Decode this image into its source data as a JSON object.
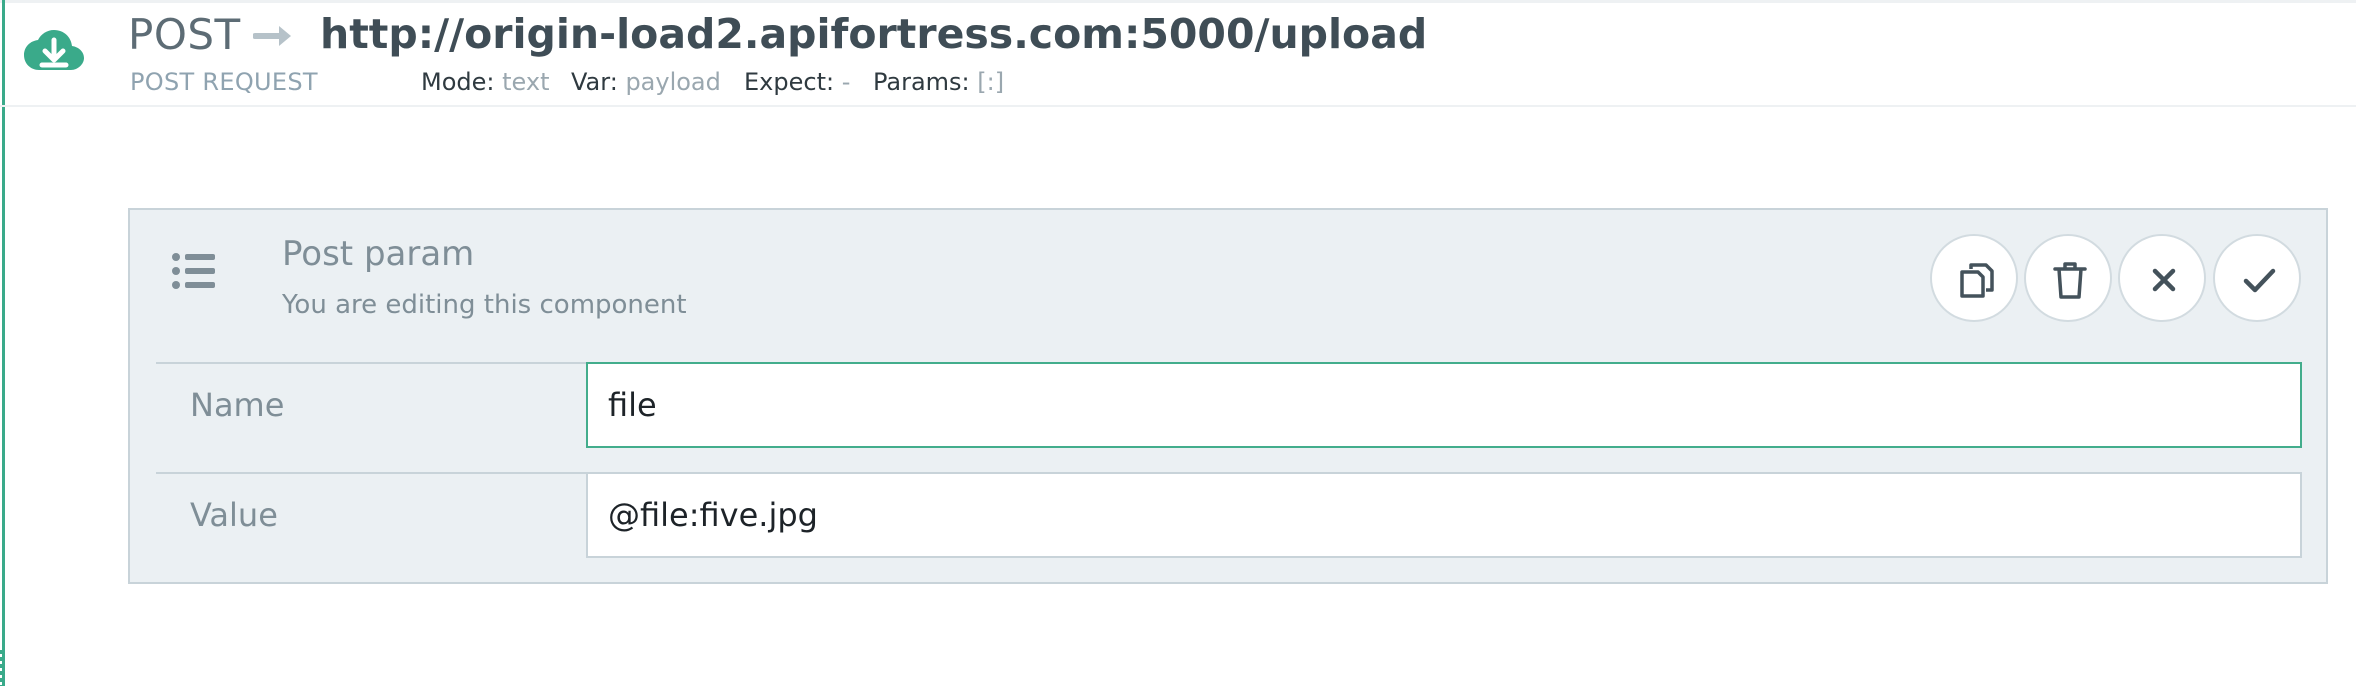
{
  "request": {
    "method": "POST",
    "url": "http://origin-load2.apifortress.com:5000/upload",
    "subtitle": "POST REQUEST",
    "mode_label": "Mode:",
    "mode_value": "text",
    "var_label": "Var:",
    "var_value": "payload",
    "expect_label": "Expect:",
    "expect_value": "-",
    "params_label": "Params:",
    "params_value": "[:]",
    "icon": "cloud-download-icon"
  },
  "component": {
    "title": "Post param",
    "subtitle": "You are editing this component",
    "icon": "list-icon",
    "actions": [
      {
        "name": "copy-icon"
      },
      {
        "name": "trash-icon"
      },
      {
        "name": "close-icon"
      },
      {
        "name": "check-icon"
      }
    ],
    "fields": {
      "name_label": "Name",
      "name_value": "file",
      "value_label": "Value",
      "value_value": "@file:five.jpg"
    }
  },
  "colors": {
    "accent": "#3aaa8a",
    "panel_bg": "#ebf0f3",
    "icon": "#44525b"
  }
}
